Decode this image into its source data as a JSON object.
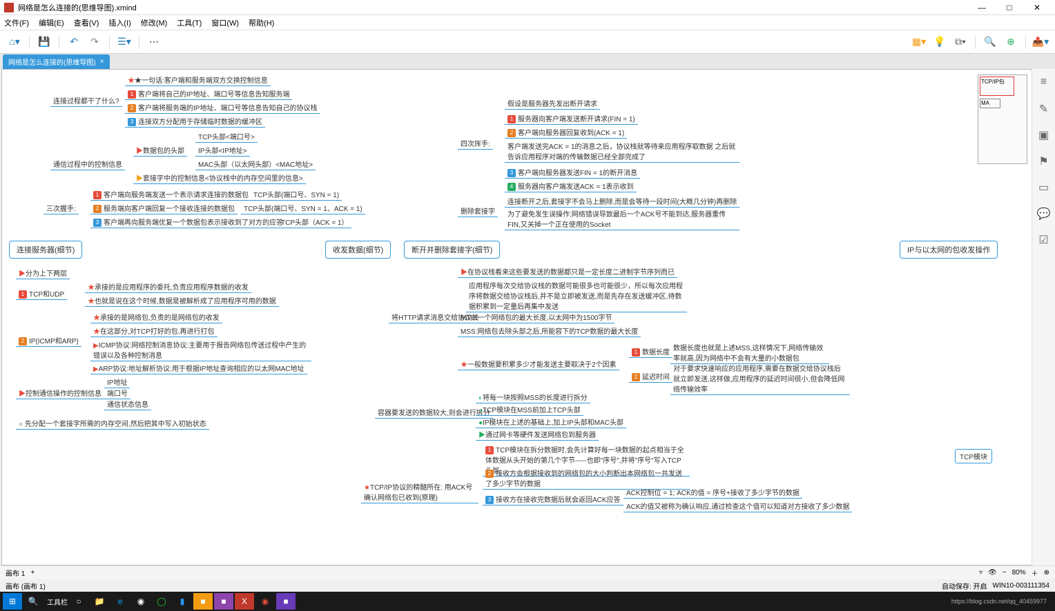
{
  "window": {
    "title": "网络是怎么连接的(思维导图).xmind",
    "min": "—",
    "max": "□",
    "close": "✕"
  },
  "menu": [
    "文件(F)",
    "编辑(E)",
    "查看(V)",
    "插入(I)",
    "修改(M)",
    "工具(T)",
    "窗口(W)",
    "帮助(H)"
  ],
  "tab": {
    "label": "网络是怎么连接的(思维导图)",
    "close": "×"
  },
  "footer": {
    "sheet": "画布 1",
    "breadcrumb": "画布 (画布 1)",
    "zoom": "80%",
    "autosave": "自动保存: 开启",
    "host": "WIN10-003111354",
    "watermark_url": "https://blog.csdn.net/qq_40459977"
  },
  "taskbar": {
    "label": "工具栏"
  },
  "minimap": {
    "lbl1": "TCP/IP包",
    "lbl2": "MA"
  },
  "right_tile": "TCP模块",
  "mm": {
    "root1": "连接服务器(细节)",
    "root2": "收发数据(细节)",
    "root3": "断开并删除套接字(细节)",
    "root4": "IP与以太网的包收发操作",
    "a1": "连接过程都干了什么?",
    "a1_star": "★一句话:客户端和服务端双方交换控制信息",
    "a1_1": "客户端将自己的IP地址、端口号等信息告知服务端",
    "a1_2": "客户端将服务端的IP地址、端口号等信息告知自己的协议栈",
    "a1_3": "连接双方分配用于存储临时数据的缓冲区",
    "a2": "通信过程中的控制信息",
    "a2_h": "数据包的头部",
    "a2_h1": "TCP头部<端口号>",
    "a2_h2": "IP头部<IP地址>",
    "a2_h3": "MAC头部（以太网头部）<MAC地址>",
    "a2_s": "套接字中的控制信息<协议栈中的内存空间里的信息>",
    "a3": "三次握手:",
    "a3_1": "客户端向服务端发送一个表示请求连接的数据包",
    "a3_1b": "TCP头部(端口号、SYN = 1)",
    "a3_2": "服务端向客户端回复一个接收连接的数据包",
    "a3_2b": "TCP头部(端口号、SYN = 1、ACK = 1)",
    "a3_3": "客户端再向服务端优复一个数据包表示接收到了对方的应答",
    "a3_3b": "TCP头部（ACK = 1）",
    "b1": "分为上下两层",
    "b2": "TCP和UDP",
    "b2_1": "承接的是应用程序的委托,负责应用程序数据的收发",
    "b2_2": "也就是说在这个时候,数据是被解析成了应用程序可用的数据",
    "b3": "IP(ICMP和ARP)",
    "b3_1": "承接的是网络包,负责的是网络包的收发",
    "b3_2": "在这部分,对TCP打好的包,再进行打包",
    "b3_3": "ICMP协议:网络控制消息协议:主要用于报告网络包传送过程中产生的错误以及各种控制消息",
    "b3_4": "ARP协议:地址解析协议:用于根据IP地址查询相应的以太网MAC地址",
    "b4": "控制通信操作的控制信息",
    "b4_1": "IP地址",
    "b4_2": "端口号",
    "b4_3": "通信状态信息",
    "b5": "先分配一个套接字所需的内存空间,然后把其中写入初始状态",
    "c0": "四次挥手:",
    "c0_pre": "假设是服务器先发出断开请求",
    "c0_1": "服务器向客户端发送断开请求(FIN = 1)",
    "c0_2": "客户端向服务器回复收到(ACK = 1)",
    "c0_3": "客户端发送完ACK = 1的消息之后，协议栈就等待来应用程序取数据  之后就告诉应用程序对端的传输数据已经全部完成了",
    "c0_4": "客户端向服务器发送FIN = 1的断开消息",
    "c0_5": "服务器向客户端发送ACK = 1表示收到",
    "c1": "删除套接字",
    "c1_1": "连接断开之后,套接字不会马上删除,而是会等待一段时间(大概几分钟)再删除",
    "c1_2": "为了避免发生误操作:网络错误导致最后一个ACK号不能到达,服务器重传FIN,又关掉一个正在使用的Socket",
    "d0": "将HTTP请求消息交给协议栈",
    "d0_1": "在协议栈看来这些要发送的数据都只是一定长度二进制字节序列而已",
    "d0_2": "应用程序每次交给协议栈的数据可能很多也可能很少，所以每次应用程序将数据交给协议栈后,并不是立即被发送,而是先存在发送缓冲区,待数据积累到一定量后再集中发送",
    "d0_3": "MTU:一个网络包的最大长度,以太网中为1500字节",
    "d0_4": "MSS:网络包去除头部之后,所能容下的TCP数据的最大长度",
    "d1": "一般数据要积累多少才能发送主要取决于2个因素",
    "d1_a": "数据长度",
    "d1_a1": "数据长度也就是上述MSS,这样情况下,网络传输效率就高,因为网络中不会有大量的小数据包",
    "d1_b": "延迟时间",
    "d1_b1": "对于要求快速响应的应用程序,需要在数据交给协议栈后就立即发送,这样做,应用程序的延迟时间很小,但会降低网络传输效率",
    "d2": "容器要发送的数据较大,则会进行拆分",
    "d2_1": "将每一块按照MSS的长度进行拆分",
    "d2_2": "TCP模块在MSS前加上TCP头部",
    "d2_3": "IP模块在上述的基础上,加上IP头部和MAC头部",
    "d2_4": "通过网卡等硬件发送网络包到服务器",
    "d3": "TCP/IP协议的精髓所在:  用ACK号确认网络包已收到(原理)",
    "d3_1": "TCP模块在拆分数据时,会先计算好每一块数据的起点相当于全体数据从头开始的第几个字节-----也即\"序号\",并将\"序号\"写入TCP头部",
    "d3_2": "接收方会根据接收到的网络包的大小判断出本网络包一共发送了多少字节的数据",
    "d3_3": "接收方在接收完数据后就会返回ACK应答",
    "d3_3a": "ACK控制位 = 1; ACK的值 = 序号+接收了多少字节的数据",
    "d3_3b": "ACK的值又被称为确认响应,通过检查这个值可以知道对方接收了多少数据"
  }
}
